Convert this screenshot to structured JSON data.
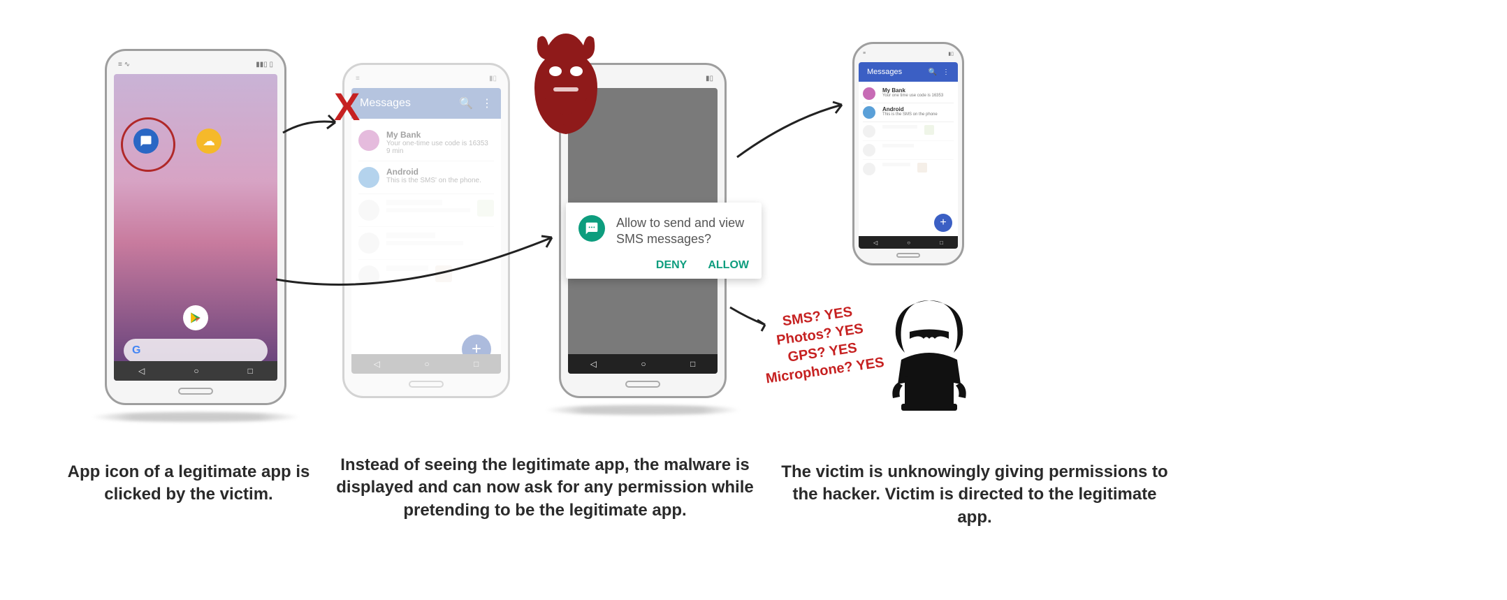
{
  "phone1": {
    "icons": {
      "messages": "Messages",
      "weather": "Weather"
    },
    "search": {
      "letter": "G"
    }
  },
  "phone2": {
    "header": {
      "title": "Messages"
    },
    "messages": [
      {
        "sender": "My Bank",
        "preview": "Your one-time use code is 16353",
        "time": "9 min"
      },
      {
        "sender": "Android",
        "preview": "This is the SMS' on the phone.",
        "time": ""
      }
    ],
    "x_mark": "X"
  },
  "phone3": {
    "dialog": {
      "text": "Allow  to send and view SMS messages?",
      "deny": "DENY",
      "allow": "ALLOW"
    }
  },
  "phone4": {
    "header": {
      "title": "Messages"
    },
    "messages": [
      {
        "sender": "My Bank",
        "preview": "Your one time use code is 16353"
      },
      {
        "sender": "Android",
        "preview": "This is the SMS on the phone"
      }
    ]
  },
  "hacker_perms": {
    "l1": "SMS? YES",
    "l2": "Photos? YES",
    "l3": "GPS? YES",
    "l4": "Microphone? YES"
  },
  "captions": {
    "c1": "App icon of a legitimate app is clicked by the victim.",
    "c2": "Instead of seeing the legitimate app, the malware is displayed and can now ask for any permission while pretending to be the legitimate app.",
    "c3": "The victim is unknowingly giving permissions to the hacker. Victim is directed to the legitimate app."
  },
  "nav": {
    "back": "◁",
    "home": "○",
    "recent": "□"
  }
}
